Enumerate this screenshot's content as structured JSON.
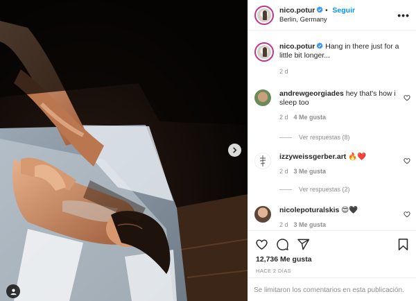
{
  "post": {
    "username": "nico.potur",
    "follow_label": "Seguir",
    "location": "Berlin, Germany",
    "more_label": "•••"
  },
  "caption": {
    "username": "nico.potur",
    "text": "Hang in there just for a little bit longer...",
    "time": "2 d"
  },
  "comments": [
    {
      "username": "andrewgeorgiades",
      "text": "hey that's how i sleep too",
      "time": "2 d",
      "likes": "4 Me gusta",
      "replies": "Ver respuestas (8)"
    },
    {
      "username": "izzyweissgerber.art",
      "text": "🔥❤️",
      "time": "2 d",
      "likes": "3 Me gusta",
      "replies": "Ver respuestas (2)"
    },
    {
      "username": "nicolepoturalskis",
      "text": "😍🖤",
      "time": "2 d",
      "likes": "3 Me gusta"
    }
  ],
  "footer": {
    "likes": "12,736 Me gusta",
    "ago": "HACE 2 DÍAS",
    "comments_limited": "Se limitaron los comentarios en esta publicación."
  },
  "colors": {
    "accent": "#0095f6",
    "muted": "#8e8e8e",
    "text": "#262626"
  },
  "icons": [
    "chevron-right-icon",
    "user-tag-icon",
    "verified-badge-icon",
    "heart-icon",
    "comment-icon",
    "share-icon",
    "bookmark-icon"
  ]
}
